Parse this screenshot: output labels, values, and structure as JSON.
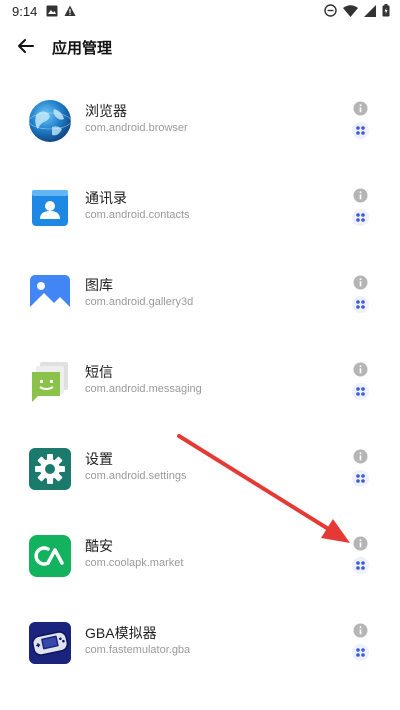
{
  "status_bar": {
    "time": "9:14",
    "left_icons": [
      "image-icon",
      "warning-icon"
    ],
    "right_icons": [
      "do-not-disturb-icon",
      "wifi-icon",
      "signal-icon",
      "battery-icon"
    ]
  },
  "header": {
    "title": "应用管理",
    "back_icon": "arrow-left-icon"
  },
  "apps": [
    {
      "name": "浏览器",
      "package": "com.android.browser",
      "icon": "globe-icon"
    },
    {
      "name": "通讯录",
      "package": "com.android.contacts",
      "icon": "contacts-icon"
    },
    {
      "name": "图库",
      "package": "com.android.gallery3d",
      "icon": "gallery-icon"
    },
    {
      "name": "短信",
      "package": "com.android.messaging",
      "icon": "messaging-icon"
    },
    {
      "name": "设置",
      "package": "com.android.settings",
      "icon": "settings-gear-icon"
    },
    {
      "name": "酷安",
      "package": "com.coolapk.market",
      "icon": "coolapk-icon"
    },
    {
      "name": "GBA模拟器",
      "package": "com.fastemulator.gba",
      "icon": "gba-console-icon"
    }
  ],
  "colors": {
    "accent_blue": "#3b5bdb",
    "info_grey": "#b5b5b5",
    "annotation_red": "#e53935"
  }
}
